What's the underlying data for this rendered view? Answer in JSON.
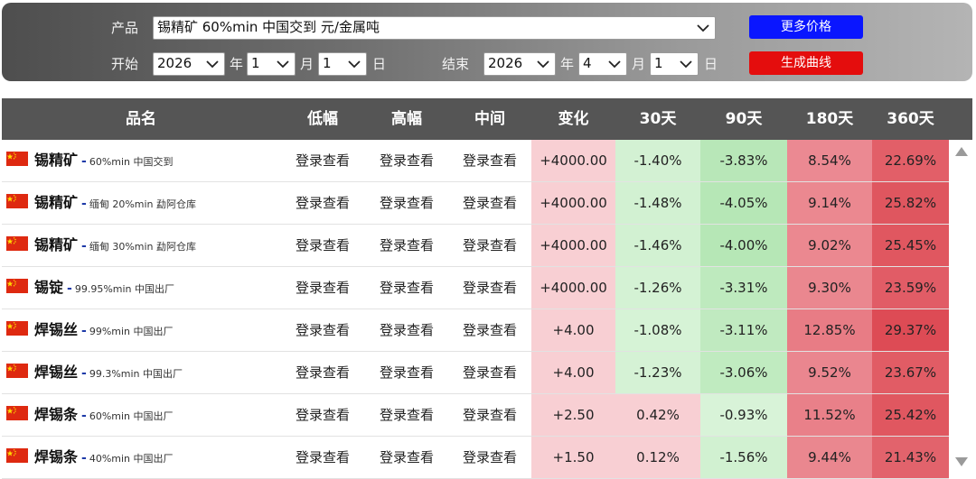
{
  "filters": {
    "product_label": "产品",
    "product_value": "锡精矿 60%min 中国交到 元/金属吨",
    "start_label": "开始",
    "end_label": "结束",
    "start_year": "2026",
    "start_month": "1",
    "start_day": "1",
    "end_year": "2026",
    "end_month": "4",
    "end_day": "1",
    "year_unit": "年",
    "month_unit": "月",
    "day_unit": "日",
    "more_prices_button": "更多价格",
    "generate_curve_button": "生成曲线"
  },
  "table": {
    "headers": {
      "name": "品名",
      "low": "低幅",
      "high": "高幅",
      "mid": "中间",
      "change": "变化",
      "d30": "30天",
      "d90": "90天",
      "d180": "180天",
      "d360": "360天"
    },
    "rows": [
      {
        "name": "锡精矿",
        "dash": "-",
        "spec": "60%min 中国交到",
        "low": "登录查看",
        "high": "登录查看",
        "mid": "登录查看",
        "change": "+4000.00",
        "d30": "-1.40%",
        "d90": "-3.83%",
        "d180": "8.54%",
        "d360": "22.69%"
      },
      {
        "name": "锡精矿",
        "dash": "-",
        "spec": "缅甸 20%min 勐阿仓库",
        "low": "登录查看",
        "high": "登录查看",
        "mid": "登录查看",
        "change": "+4000.00",
        "d30": "-1.48%",
        "d90": "-4.05%",
        "d180": "9.14%",
        "d360": "25.82%"
      },
      {
        "name": "锡精矿",
        "dash": "-",
        "spec": "缅甸 30%min 勐阿仓库",
        "low": "登录查看",
        "high": "登录查看",
        "mid": "登录查看",
        "change": "+4000.00",
        "d30": "-1.46%",
        "d90": "-4.00%",
        "d180": "9.02%",
        "d360": "25.45%"
      },
      {
        "name": "锡锭",
        "dash": "-",
        "spec": "99.95%min 中国出厂",
        "low": "登录查看",
        "high": "登录查看",
        "mid": "登录查看",
        "change": "+4000.00",
        "d30": "-1.26%",
        "d90": "-3.31%",
        "d180": "9.30%",
        "d360": "23.59%"
      },
      {
        "name": "焊锡丝",
        "dash": "-",
        "spec": "99%min 中国出厂",
        "low": "登录查看",
        "high": "登录查看",
        "mid": "登录查看",
        "change": "+4.00",
        "d30": "-1.08%",
        "d90": "-3.11%",
        "d180": "12.85%",
        "d360": "29.37%"
      },
      {
        "name": "焊锡丝",
        "dash": "-",
        "spec": "99.3%min 中国出厂",
        "low": "登录查看",
        "high": "登录查看",
        "mid": "登录查看",
        "change": "+4.00",
        "d30": "-1.23%",
        "d90": "-3.06%",
        "d180": "9.52%",
        "d360": "23.67%"
      },
      {
        "name": "焊锡条",
        "dash": "-",
        "spec": "60%min 中国出厂",
        "low": "登录查看",
        "high": "登录查看",
        "mid": "登录查看",
        "change": "+2.50",
        "d30": "0.42%",
        "d90": "-0.93%",
        "d180": "11.52%",
        "d360": "25.42%"
      },
      {
        "name": "焊锡条",
        "dash": "-",
        "spec": "40%min 中国出厂",
        "low": "登录查看",
        "high": "登录查看",
        "mid": "登录查看",
        "change": "+1.50",
        "d30": "0.12%",
        "d90": "-1.56%",
        "d180": "9.44%",
        "d360": "21.43%"
      }
    ]
  },
  "colors": {
    "more_button": "#0a16ff",
    "curve_button": "#e40d0d",
    "header_bg": "#555555",
    "change_bg": "#f8cfd3",
    "flag_red": "#de2910",
    "flag_star": "#ffde00"
  },
  "icons": {
    "flag": "china-flag-icon",
    "dropdown": "chevron-down-icon",
    "scroll_up": "scroll-up-arrow-icon",
    "scroll_down": "scroll-down-arrow-icon"
  }
}
